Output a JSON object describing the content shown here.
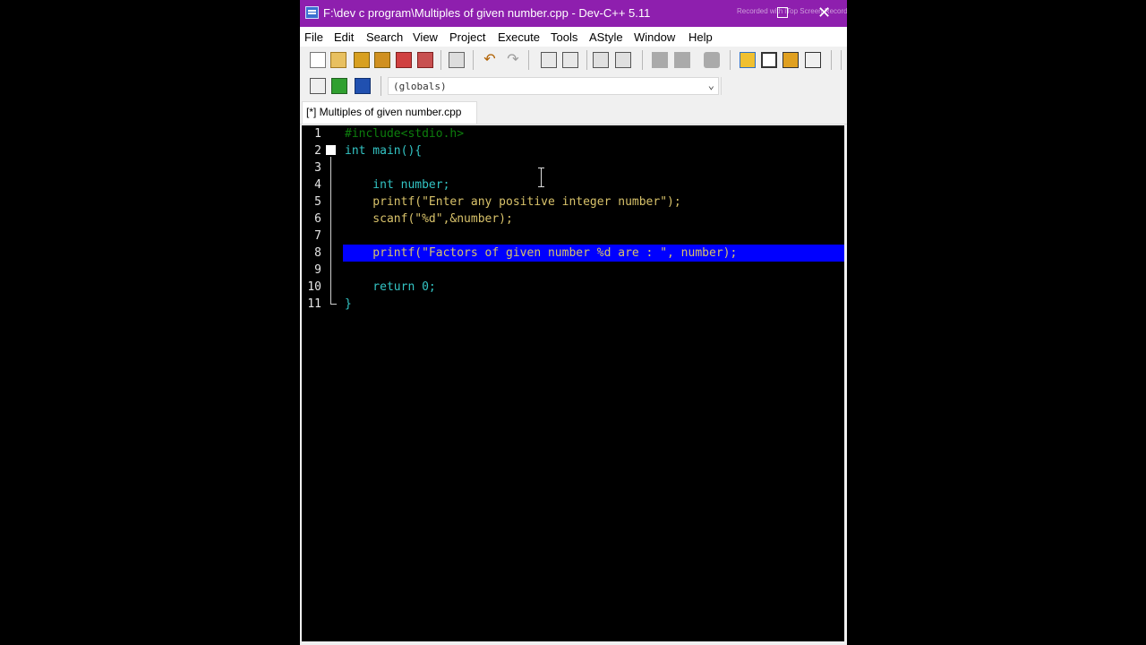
{
  "window": {
    "title": "F:\\dev c program\\Multiples of given number.cpp - Dev-C++ 5.11",
    "watermark": "Recorded with iTop Screen Recorder"
  },
  "menu": [
    "File",
    "Edit",
    "Search",
    "View",
    "Project",
    "Execute",
    "Tools",
    "AStyle",
    "Window",
    "Help"
  ],
  "toolbar": {
    "scope_combo_value": "(globals)"
  },
  "tabs": [
    {
      "label": "[*] Multiples of given number.cpp",
      "active": true
    }
  ],
  "editor": {
    "highlighted_line": 8,
    "lines": [
      {
        "num": "1",
        "text": "#include<stdio.h>"
      },
      {
        "num": "2",
        "text": "int main(){"
      },
      {
        "num": "3",
        "text": ""
      },
      {
        "num": "4",
        "text": "    int number;"
      },
      {
        "num": "5",
        "text": "    printf(\"Enter any positive integer number\");"
      },
      {
        "num": "6",
        "text": "    scanf(\"%d\",&number);"
      },
      {
        "num": "7",
        "text": ""
      },
      {
        "num": "8",
        "text": "    printf(\"Factors of given number %d are : \", number);"
      },
      {
        "num": "9",
        "text": ""
      },
      {
        "num": "10",
        "text": "    return 0;"
      },
      {
        "num": "11",
        "text": "}"
      }
    ]
  },
  "colors": {
    "titlebar": "#8e1fae",
    "editor_bg": "#000000",
    "selection": "#0000ff",
    "keyword": "#33c4c4",
    "string": "#d8c26a",
    "preprocessor": "#0d7d0d",
    "number": "#a000a0"
  }
}
